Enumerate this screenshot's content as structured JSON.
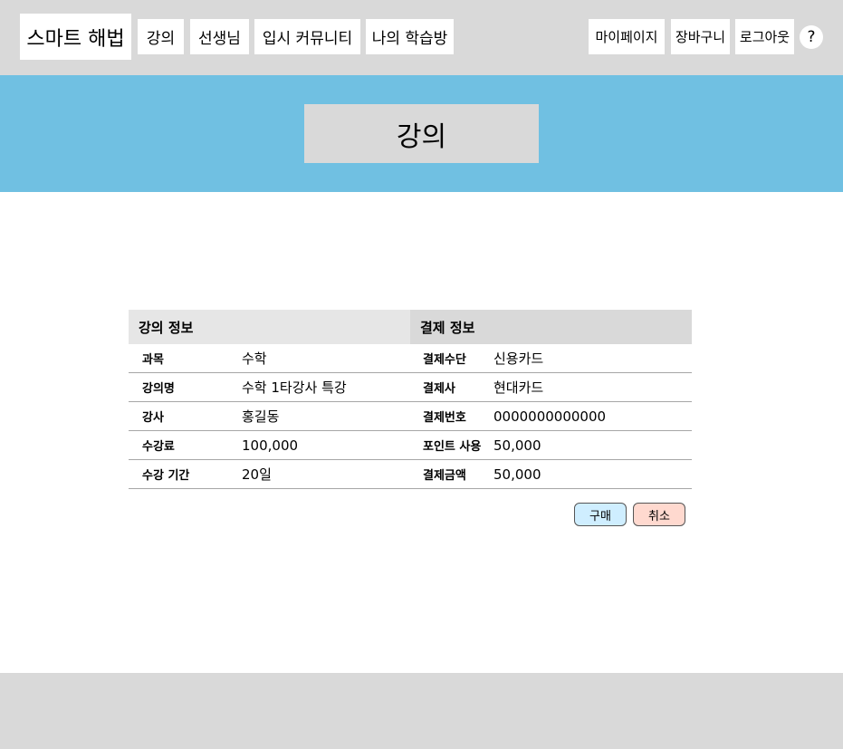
{
  "header": {
    "brand": "스마트 해법",
    "nav": [
      "강의",
      "선생님",
      "입시 커뮤니티",
      "나의 학습방"
    ],
    "mypage": "마이페이지",
    "cart": "장바구니",
    "logout": "로그아웃",
    "help": "?"
  },
  "banner": {
    "title": "강의"
  },
  "lecture_info": {
    "heading": "강의 정보",
    "rows": [
      {
        "label": "과목",
        "value": "수학"
      },
      {
        "label": "강의명",
        "value": "수학 1타강사 특강"
      },
      {
        "label": "강사",
        "value": "홍길동"
      },
      {
        "label": "수강료",
        "value": "100,000"
      },
      {
        "label": "수강 기간",
        "value": "20일"
      }
    ]
  },
  "payment_info": {
    "heading": "결제 정보",
    "rows": [
      {
        "label": "결제수단",
        "value": "신용카드"
      },
      {
        "label": "결제사",
        "value": "현대카드"
      },
      {
        "label": "결제번호",
        "value": "0000000000000"
      },
      {
        "label": "포인트 사용",
        "value": "50,000"
      },
      {
        "label": "결제금액",
        "value": "50,000"
      }
    ]
  },
  "actions": {
    "buy": "구매",
    "cancel": "취소"
  },
  "colors": {
    "header_bg": "#d9d9d9",
    "banner_bg": "#70c0e2",
    "buy_bg": "#cfeeff",
    "cancel_bg": "#ffd9cf"
  }
}
